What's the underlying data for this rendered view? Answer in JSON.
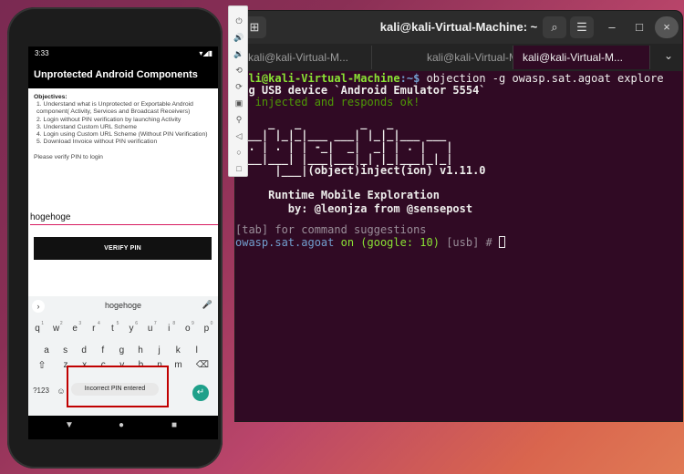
{
  "terminal": {
    "title": "kali@kali-Virtual-Machine: ~",
    "tabs": [
      "kali@kali-Virtual-M...",
      "kali@kali-Virtual-M...",
      "kali@kali-Virtual-M..."
    ],
    "lines": {
      "cmd_user": "kali@kali-Virtual-Machine",
      "cmd_sep": ":~$",
      "cmd": " objection -g owasp.sat.agoat explore",
      "l2": "ing USB device `Android Emulator 5554`",
      "l3": "nt injected and responds ok!",
      "a1": "     _   _         _   _",
      "a2": " ___| |_|_|___ ___| |_|_|___ ___",
      "a3": "| . | . | | -_|  _|  _| | . |   |",
      "a4": "|___|___| |___|___|_| |_|___|_|_|",
      "a5": "      |___|(object)inject(ion) v1.11.0",
      "r1": "     Runtime Mobile Exploration",
      "r2": "        by: @leonjza from @sensepost",
      "hint": "[tab] for command suggestions",
      "p_app": "owasp.sat.agoat",
      "p_on": " on ",
      "p_dev": "(google: 10)",
      "p_usb": " [usb] # "
    }
  },
  "phone": {
    "time": "3:33",
    "app_title": "Unprotected Android Components",
    "objectives_label": "Objectives:",
    "objectives": [
      "1. Understand what is Unprotected or Exportable Android component( Activity, Services and Broadcast Receivers)",
      "2. Login without PIN verification by launching Activity",
      "3. Understand Custom URL Scheme",
      "4. Login using Custom URL Scheme (Without PIN Verification)",
      "5. Download Invoice without PIN verification"
    ],
    "pin_prompt": "Please verify PIN to login",
    "pin_value": "hogehoge",
    "verify_label": "VERIFY PIN",
    "suggestion": "hogehoge",
    "keys_row1": [
      "q",
      "w",
      "e",
      "r",
      "t",
      "y",
      "u",
      "i",
      "o",
      "p"
    ],
    "keys_row1_nums": [
      "1",
      "2",
      "3",
      "4",
      "5",
      "6",
      "7",
      "8",
      "9",
      "0"
    ],
    "keys_row2": [
      "a",
      "s",
      "d",
      "f",
      "g",
      "h",
      "j",
      "k",
      "l"
    ],
    "keys_row3": [
      "z",
      "x",
      "c",
      "v",
      "b",
      "n",
      "m"
    ],
    "key_symbols": "?123",
    "toast": "Incorrect PIN entered"
  }
}
